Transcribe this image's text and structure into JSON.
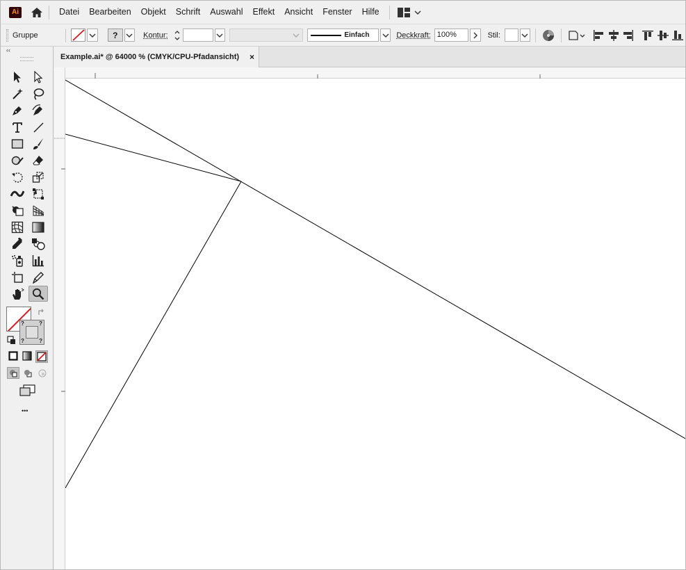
{
  "app": {
    "logo_text": "Ai"
  },
  "menu": {
    "items": [
      "Datei",
      "Bearbeiten",
      "Objekt",
      "Schrift",
      "Auswahl",
      "Effekt",
      "Ansicht",
      "Fenster",
      "Hilfe"
    ]
  },
  "control": {
    "selection": "Gruppe",
    "stroke_label": "Kontur:",
    "fill_unknown": "?",
    "stroke_style": "Einfach",
    "opacity_label": "Deckkraft:",
    "opacity_value": "100%",
    "style_label": "Stil:"
  },
  "toolbox": {
    "collapse": "‹‹",
    "unknown_mark": "?",
    "more": "•••"
  },
  "document": {
    "tab_title": "Example.ai* @ 64000 % (CMYK/CPU-Pfadansicht)",
    "close": "×"
  },
  "colors": {
    "none_slash": "#d8181c",
    "accent_bg": "#f0f0f0",
    "logo_bg": "#330000",
    "logo_fg": "#ff9a00"
  }
}
